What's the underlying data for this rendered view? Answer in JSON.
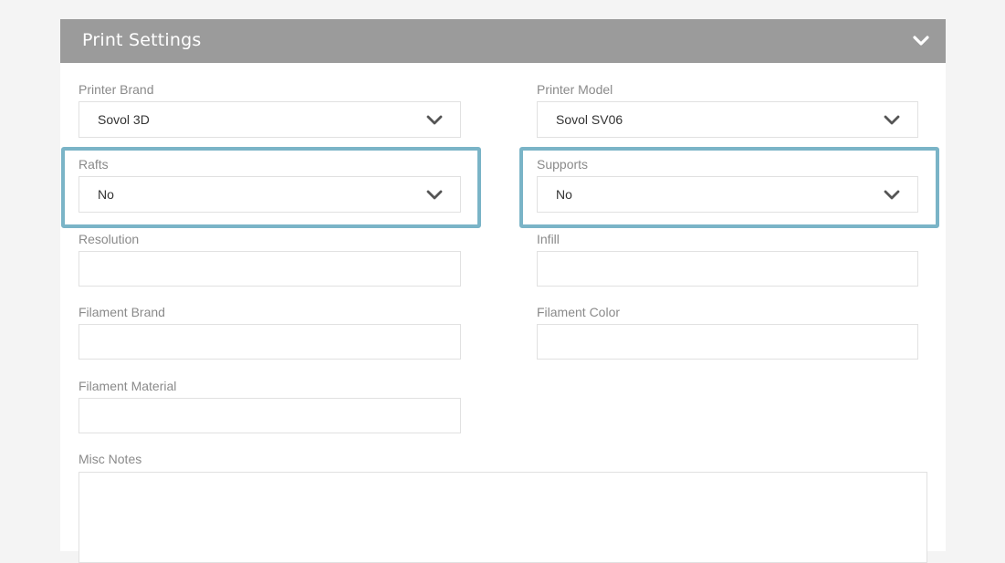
{
  "header": {
    "title": "Print Settings",
    "collapse_icon": "chevron-down-icon"
  },
  "colors": {
    "header_bg": "#9b9b9b",
    "highlight": "#7ab4c7",
    "page_bg": "#f4f4f4"
  },
  "fields": {
    "printer_brand": {
      "label": "Printer Brand",
      "value": "Sovol 3D"
    },
    "printer_model": {
      "label": "Printer Model",
      "value": "Sovol SV06"
    },
    "rafts": {
      "label": "Rafts",
      "value": "No"
    },
    "supports": {
      "label": "Supports",
      "value": "No"
    },
    "resolution": {
      "label": "Resolution",
      "value": ""
    },
    "infill": {
      "label": "Infill",
      "value": ""
    },
    "filament_brand": {
      "label": "Filament Brand",
      "value": ""
    },
    "filament_color": {
      "label": "Filament Color",
      "value": ""
    },
    "filament_material": {
      "label": "Filament Material",
      "value": ""
    },
    "misc_notes": {
      "label": "Misc Notes",
      "value": ""
    }
  }
}
